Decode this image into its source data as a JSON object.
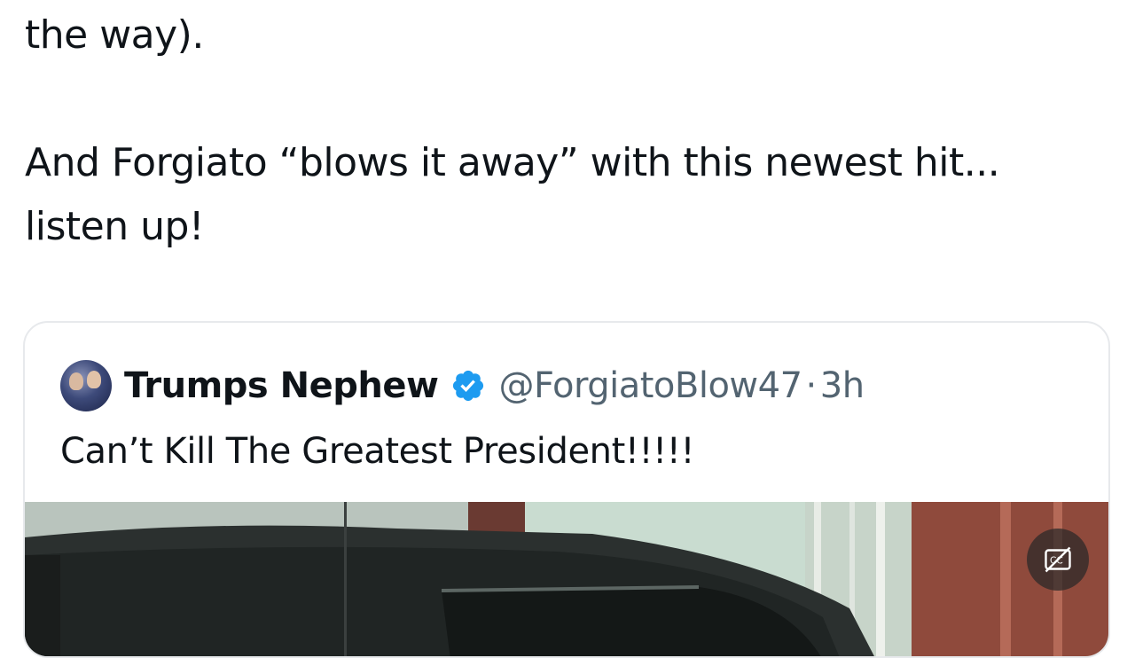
{
  "tweet": {
    "lines": [
      "the way).",
      "And Forgiato “blows it away” with this newest hit...",
      "listen up!"
    ]
  },
  "quoted_tweet": {
    "display_name": "Trumps Nephew",
    "handle": "@ForgiatoBlow47",
    "separator": "·",
    "time": "3h",
    "text": "Can’t Kill The Greatest President!!!!!",
    "verified_badge_color": "#1d9bf0",
    "media": {
      "icon": "captions-icon"
    }
  },
  "colors": {
    "text_primary": "#0f1419",
    "text_secondary": "#536471",
    "border": "#e7e9ec"
  }
}
